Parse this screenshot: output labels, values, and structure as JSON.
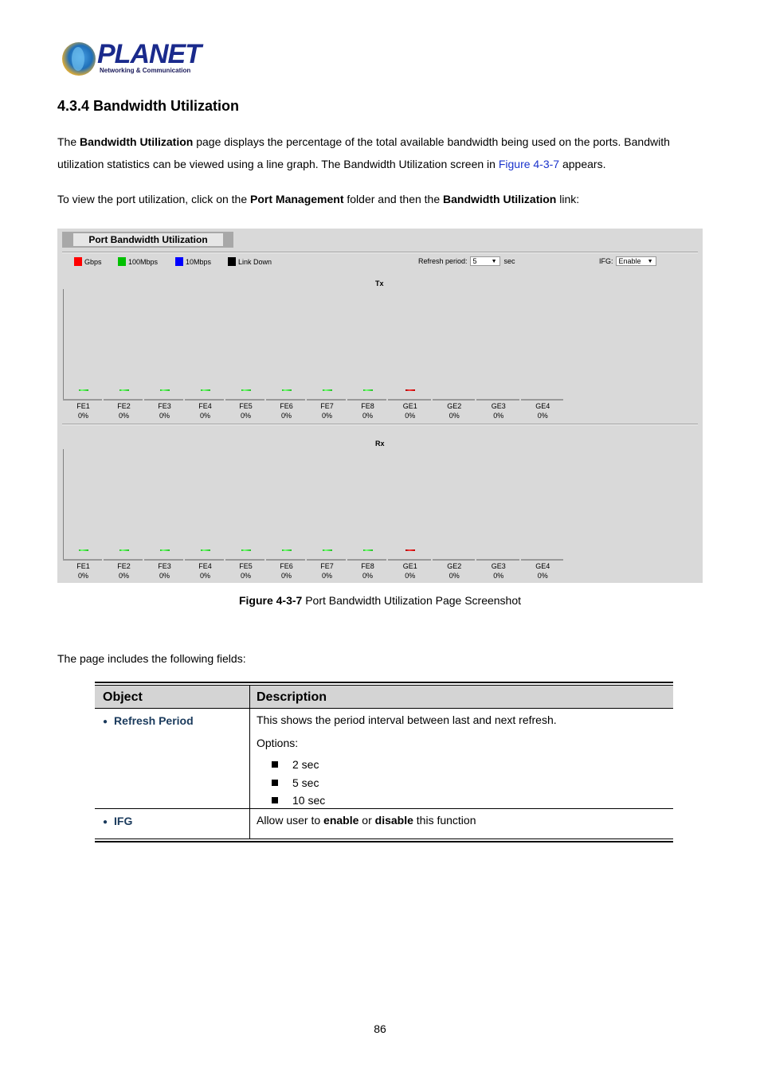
{
  "logo": {
    "brand": "PLANET",
    "tagline": "Networking & Communication"
  },
  "heading": "4.3.4 Bandwidth Utilization",
  "paragraph1": {
    "t1": "The ",
    "b1": "Bandwidth Utilization",
    "t2": " page displays the percentage of the total available bandwidth being used on the ports. Bandwith",
    "t3": "utilization statistics can be viewed using a line graph. The Bandwidth Utilization screen in ",
    "link": "Figure 4-3-7",
    "t4": " appears."
  },
  "paragraph2": {
    "t1": "To view the port utilization, click on the ",
    "b1": "Port Management",
    "t2": " folder and then the ",
    "b2": "Bandwidth Utilization",
    "t3": " link:"
  },
  "screenshot": {
    "title": "Port Bandwidth Utilization",
    "legend": [
      {
        "label": "Gbps",
        "color": "#ff0000"
      },
      {
        "label": "100Mbps",
        "color": "#00c000"
      },
      {
        "label": "10Mbps",
        "color": "#0000ff"
      },
      {
        "label": "Link Down",
        "color": "#000000"
      }
    ],
    "refresh_label": "Refresh period:",
    "refresh_value": "5",
    "refresh_unit": "sec",
    "ifg_label": "IFG:",
    "ifg_value": "Enable",
    "tx_label": "Tx",
    "rx_label": "Rx",
    "ports": [
      {
        "name": "FE1",
        "tx": "0%",
        "rx": "0%",
        "speed": "100Mbps"
      },
      {
        "name": "FE2",
        "tx": "0%",
        "rx": "0%",
        "speed": "100Mbps"
      },
      {
        "name": "FE3",
        "tx": "0%",
        "rx": "0%",
        "speed": "100Mbps"
      },
      {
        "name": "FE4",
        "tx": "0%",
        "rx": "0%",
        "speed": "100Mbps"
      },
      {
        "name": "FE5",
        "tx": "0%",
        "rx": "0%",
        "speed": "100Mbps"
      },
      {
        "name": "FE6",
        "tx": "0%",
        "rx": "0%",
        "speed": "100Mbps"
      },
      {
        "name": "FE7",
        "tx": "0%",
        "rx": "0%",
        "speed": "100Mbps"
      },
      {
        "name": "FE8",
        "tx": "0%",
        "rx": "0%",
        "speed": "100Mbps"
      },
      {
        "name": "GE1",
        "tx": "0%",
        "rx": "0%",
        "speed": "Gbps"
      },
      {
        "name": "GE2",
        "tx": "0%",
        "rx": "0%",
        "speed": "none"
      },
      {
        "name": "GE3",
        "tx": "0%",
        "rx": "0%",
        "speed": "none"
      },
      {
        "name": "GE4",
        "tx": "0%",
        "rx": "0%",
        "speed": "none"
      }
    ]
  },
  "caption": {
    "bold": "Figure 4-3-7",
    "text": " Port Bandwidth Utilization Page Screenshot"
  },
  "fields_intro": "The page includes the following fields:",
  "table": {
    "headers": [
      "Object",
      "Description"
    ],
    "rows": [
      {
        "object": "Refresh Period",
        "description": "This shows the period interval between last and next refresh.",
        "options_label": "Options:",
        "options": [
          "2 sec",
          "5 sec",
          "10 sec"
        ]
      },
      {
        "object": "IFG",
        "d1": "Allow user to ",
        "b1": "enable",
        "d2": " or ",
        "b2": "disable",
        "d3": " this function"
      }
    ]
  },
  "page_number": "86"
}
